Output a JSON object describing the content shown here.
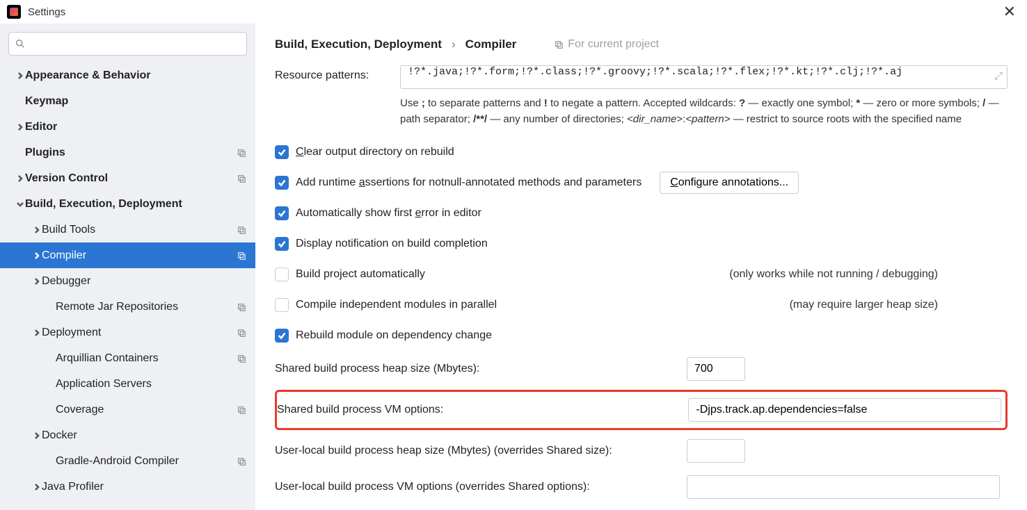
{
  "window": {
    "title": "Settings"
  },
  "sidebar": {
    "search_placeholder": "",
    "items": [
      {
        "label": "Appearance & Behavior"
      },
      {
        "label": "Keymap"
      },
      {
        "label": "Editor"
      },
      {
        "label": "Plugins"
      },
      {
        "label": "Version Control"
      },
      {
        "label": "Build, Execution, Deployment"
      },
      {
        "label": "Build Tools"
      },
      {
        "label": "Compiler"
      },
      {
        "label": "Debugger"
      },
      {
        "label": "Remote Jar Repositories"
      },
      {
        "label": "Deployment"
      },
      {
        "label": "Arquillian Containers"
      },
      {
        "label": "Application Servers"
      },
      {
        "label": "Coverage"
      },
      {
        "label": "Docker"
      },
      {
        "label": "Gradle-Android Compiler"
      },
      {
        "label": "Java Profiler"
      }
    ]
  },
  "breadcrumb": {
    "a": "Build, Execution, Deployment",
    "b": "Compiler",
    "hint": "For current project"
  },
  "compiler": {
    "resource_patterns_label": "Resource patterns:",
    "resource_patterns_value": "!?*.java;!?*.form;!?*.class;!?*.groovy;!?*.scala;!?*.flex;!?*.kt;!?*.clj;!?*.aj",
    "help_a": "Use ",
    "help_b": " to separate patterns and ",
    "help_c": " to negate a pattern. Accepted wildcards: ",
    "help_d": " — exactly one symbol; ",
    "help_e": " — zero or more symbols; ",
    "help_f": " — path separator; ",
    "help_g": " — any number of directories; ",
    "help_h": " — restrict to source roots with the specified name",
    "cb_clear": "lear output directory on rebuild",
    "cb_assert_a": "Add runtime ",
    "cb_assert_b": "ssertions for notnull-annotated methods and parameters",
    "btn_configure_a": "onfigure annotations...",
    "cb_firsterr_a": "Automatically show first ",
    "cb_firsterr_b": "rror in editor",
    "cb_notify": "Display notification on build completion",
    "cb_auto": "Build project automatically",
    "cb_auto_side": "(only works while not running / debugging)",
    "cb_parallel": "Compile independent modules in parallel",
    "cb_parallel_side": "(may require larger heap size)",
    "cb_rebuild": "Rebuild module on dependency change",
    "f_shared_heap_label": "Shared build process heap size (Mbytes):",
    "f_shared_heap_value": "700",
    "f_shared_vm_label": "Shared build process VM options:",
    "f_shared_vm_value": "-Djps.track.ap.dependencies=false",
    "f_user_heap_label": "User-local build process heap size (Mbytes) (overrides Shared size):",
    "f_user_heap_value": "",
    "f_user_vm_label": "User-local build process VM options (overrides Shared options):",
    "f_user_vm_value": ""
  }
}
